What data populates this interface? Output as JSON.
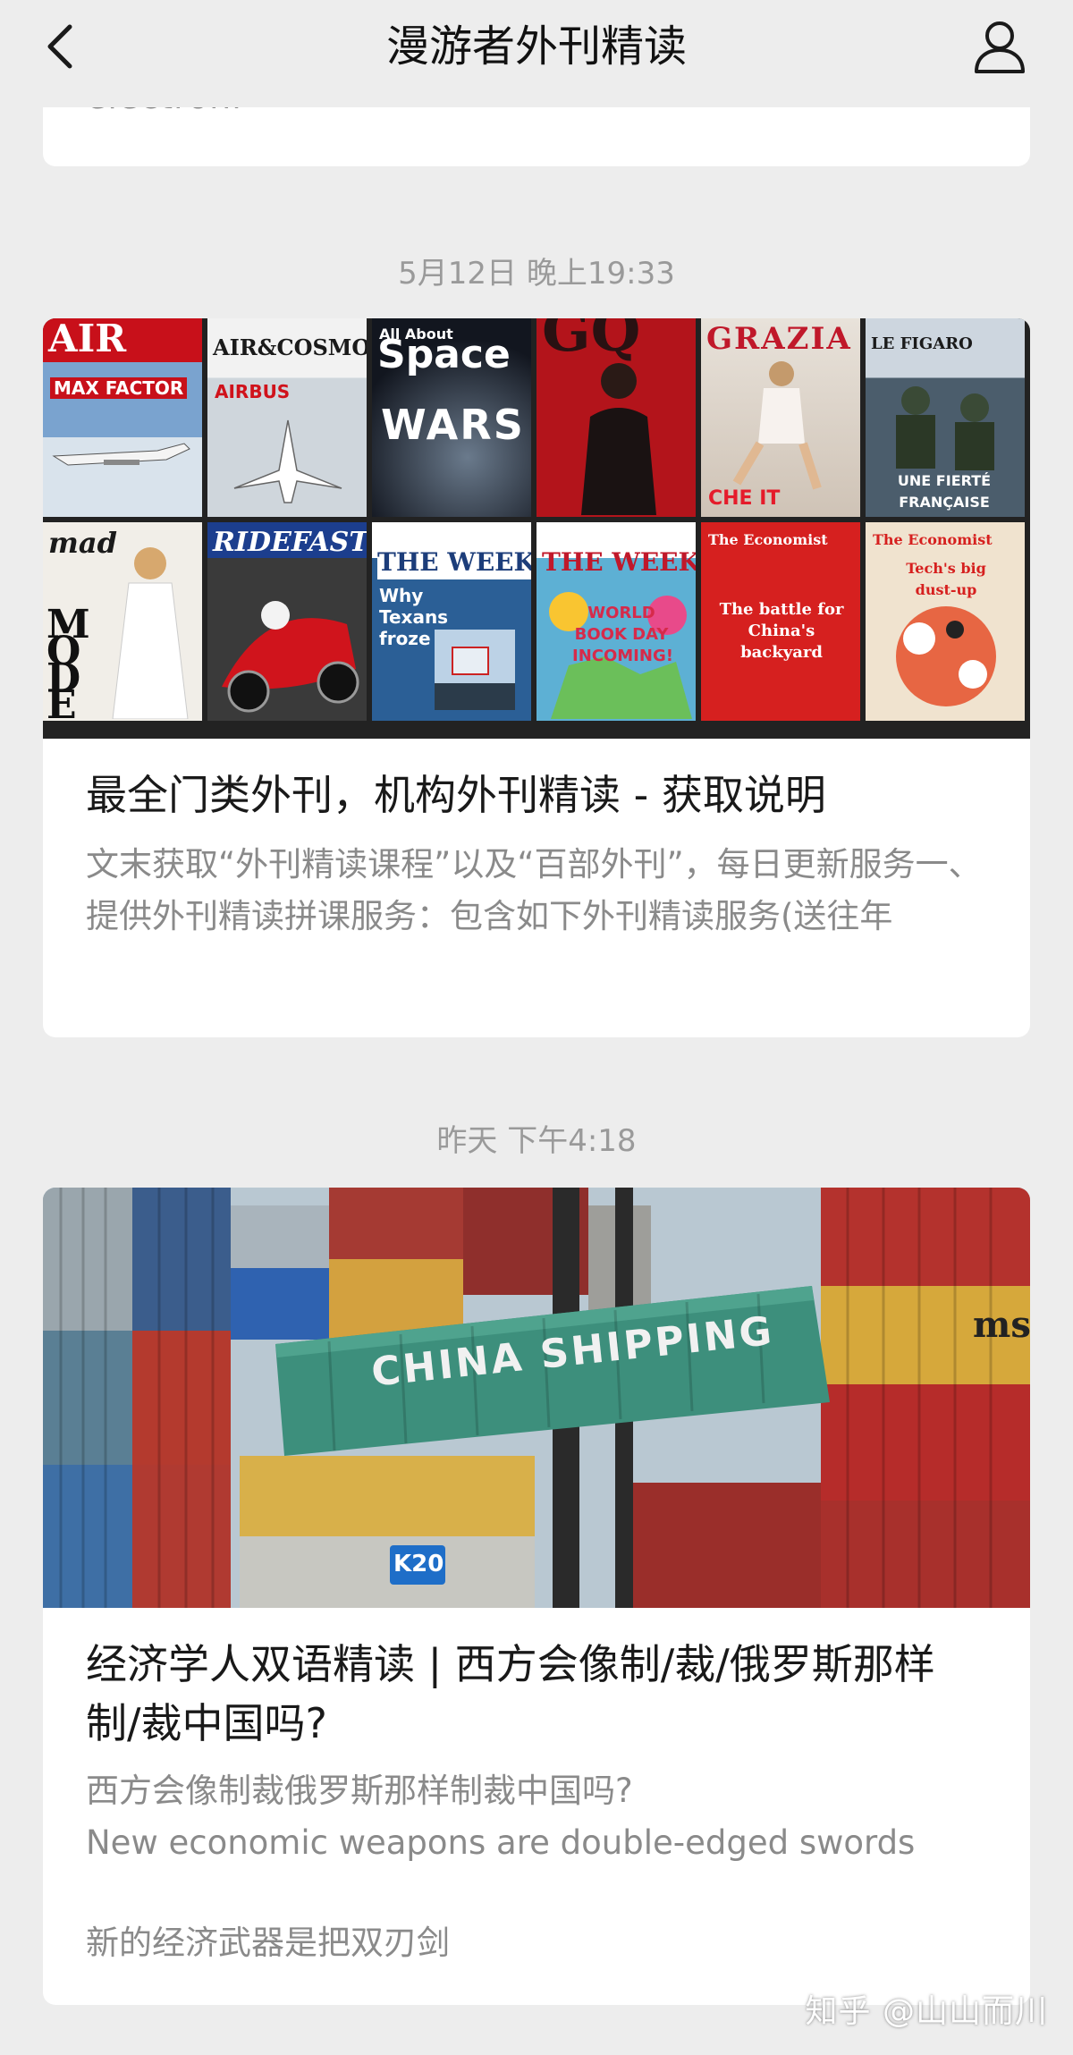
{
  "header": {
    "title": "漫游者外刊精读"
  },
  "previous_card": {
    "truncated_text": "electroni"
  },
  "articles": [
    {
      "timestamp": "5月12日 晚上19:33",
      "title": "最全门类外刊，机构外刊精读 - 获取说明",
      "description": "文末获取“外刊精读课程”以及“百部外刊”，每日更新服务一、提供外刊精读拼课服务：包含如下外刊精读服务(送往年",
      "cover_magazines": [
        {
          "name": "AIR",
          "sub": "MAX FACTOR",
          "color": "#c8101a"
        },
        {
          "name": "AIR&COSMOS",
          "sub": "AIRBUS",
          "color": "#e9e9ea"
        },
        {
          "name": "Space",
          "sub": "WARS",
          "color": "#1a2230"
        },
        {
          "name": "GQ",
          "sub": "",
          "color": "#b3141b"
        },
        {
          "name": "GRAZIA",
          "sub": "CHE IT",
          "color": "#d9d3cc"
        },
        {
          "name": "LE FIGARO",
          "sub": "UNE FIERTÉ FRANÇAISE",
          "color": "#3c4e5f"
        },
        {
          "name": "mad",
          "sub": "MODE",
          "color": "#f1eee8"
        },
        {
          "name": "RIDEFAST",
          "sub": "",
          "color": "#1c3e8e"
        },
        {
          "name": "THE WEEK",
          "sub": "Why Texans froze",
          "color": "#2b5f96"
        },
        {
          "name": "THE WEEK",
          "sub": "WORLD BOOK DAY INCOMING!",
          "color": "#5db0d4"
        },
        {
          "name": "The Economist",
          "sub": "The battle for China's backyard",
          "color": "#d6201f"
        },
        {
          "name": "The Economist",
          "sub": "Tech's big dust-up",
          "color": "#e5502a"
        }
      ]
    },
    {
      "timestamp": "昨天 下午4:18",
      "title": "经济学人双语精读 | 西方会像制/裁/俄罗斯那样制/裁中国吗?",
      "description_lines": [
        "西方会像制裁俄罗斯那样制裁中国吗?",
        "New economic weapons are double-edged swords",
        "",
        "新的经济武器是把双刃剑"
      ],
      "cover_texts": {
        "main_container": "CHINA SHIPPING",
        "tag": "K20",
        "brand": "msc"
      }
    }
  ],
  "watermark": "知乎 @山山而川",
  "colors": {
    "background": "#ededed",
    "card": "#ffffff",
    "title_text": "#191919",
    "desc_text": "#8a8a8a",
    "timestamp_text": "#9a9a9a"
  },
  "icons": {
    "back": "chevron-left-icon",
    "profile": "person-icon"
  }
}
